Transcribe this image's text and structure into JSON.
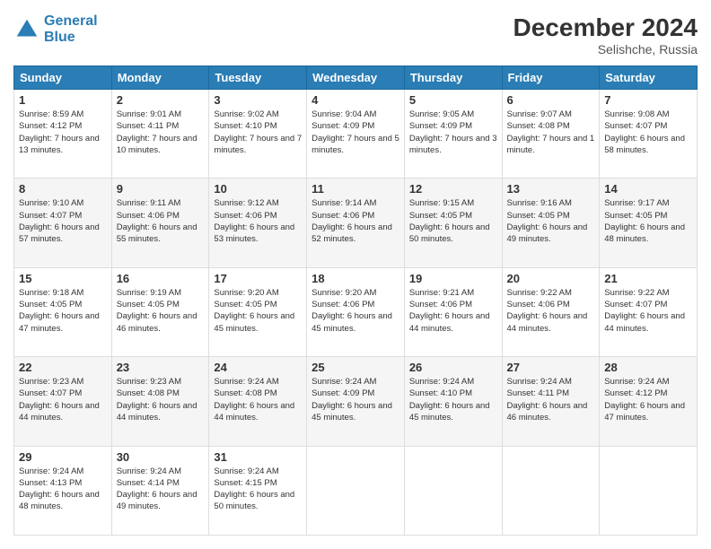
{
  "logo": {
    "line1": "General",
    "line2": "Blue"
  },
  "title": "December 2024",
  "location": "Selishche, Russia",
  "days_header": [
    "Sunday",
    "Monday",
    "Tuesday",
    "Wednesday",
    "Thursday",
    "Friday",
    "Saturday"
  ],
  "weeks": [
    [
      {
        "day": "1",
        "sunrise": "8:59 AM",
        "sunset": "4:12 PM",
        "daylight": "7 hours and 13 minutes."
      },
      {
        "day": "2",
        "sunrise": "9:01 AM",
        "sunset": "4:11 PM",
        "daylight": "7 hours and 10 minutes."
      },
      {
        "day": "3",
        "sunrise": "9:02 AM",
        "sunset": "4:10 PM",
        "daylight": "7 hours and 7 minutes."
      },
      {
        "day": "4",
        "sunrise": "9:04 AM",
        "sunset": "4:09 PM",
        "daylight": "7 hours and 5 minutes."
      },
      {
        "day": "5",
        "sunrise": "9:05 AM",
        "sunset": "4:09 PM",
        "daylight": "7 hours and 3 minutes."
      },
      {
        "day": "6",
        "sunrise": "9:07 AM",
        "sunset": "4:08 PM",
        "daylight": "7 hours and 1 minute."
      },
      {
        "day": "7",
        "sunrise": "9:08 AM",
        "sunset": "4:07 PM",
        "daylight": "6 hours and 58 minutes."
      }
    ],
    [
      {
        "day": "8",
        "sunrise": "9:10 AM",
        "sunset": "4:07 PM",
        "daylight": "6 hours and 57 minutes."
      },
      {
        "day": "9",
        "sunrise": "9:11 AM",
        "sunset": "4:06 PM",
        "daylight": "6 hours and 55 minutes."
      },
      {
        "day": "10",
        "sunrise": "9:12 AM",
        "sunset": "4:06 PM",
        "daylight": "6 hours and 53 minutes."
      },
      {
        "day": "11",
        "sunrise": "9:14 AM",
        "sunset": "4:06 PM",
        "daylight": "6 hours and 52 minutes."
      },
      {
        "day": "12",
        "sunrise": "9:15 AM",
        "sunset": "4:05 PM",
        "daylight": "6 hours and 50 minutes."
      },
      {
        "day": "13",
        "sunrise": "9:16 AM",
        "sunset": "4:05 PM",
        "daylight": "6 hours and 49 minutes."
      },
      {
        "day": "14",
        "sunrise": "9:17 AM",
        "sunset": "4:05 PM",
        "daylight": "6 hours and 48 minutes."
      }
    ],
    [
      {
        "day": "15",
        "sunrise": "9:18 AM",
        "sunset": "4:05 PM",
        "daylight": "6 hours and 47 minutes."
      },
      {
        "day": "16",
        "sunrise": "9:19 AM",
        "sunset": "4:05 PM",
        "daylight": "6 hours and 46 minutes."
      },
      {
        "day": "17",
        "sunrise": "9:20 AM",
        "sunset": "4:05 PM",
        "daylight": "6 hours and 45 minutes."
      },
      {
        "day": "18",
        "sunrise": "9:20 AM",
        "sunset": "4:06 PM",
        "daylight": "6 hours and 45 minutes."
      },
      {
        "day": "19",
        "sunrise": "9:21 AM",
        "sunset": "4:06 PM",
        "daylight": "6 hours and 44 minutes."
      },
      {
        "day": "20",
        "sunrise": "9:22 AM",
        "sunset": "4:06 PM",
        "daylight": "6 hours and 44 minutes."
      },
      {
        "day": "21",
        "sunrise": "9:22 AM",
        "sunset": "4:07 PM",
        "daylight": "6 hours and 44 minutes."
      }
    ],
    [
      {
        "day": "22",
        "sunrise": "9:23 AM",
        "sunset": "4:07 PM",
        "daylight": "6 hours and 44 minutes."
      },
      {
        "day": "23",
        "sunrise": "9:23 AM",
        "sunset": "4:08 PM",
        "daylight": "6 hours and 44 minutes."
      },
      {
        "day": "24",
        "sunrise": "9:24 AM",
        "sunset": "4:08 PM",
        "daylight": "6 hours and 44 minutes."
      },
      {
        "day": "25",
        "sunrise": "9:24 AM",
        "sunset": "4:09 PM",
        "daylight": "6 hours and 45 minutes."
      },
      {
        "day": "26",
        "sunrise": "9:24 AM",
        "sunset": "4:10 PM",
        "daylight": "6 hours and 45 minutes."
      },
      {
        "day": "27",
        "sunrise": "9:24 AM",
        "sunset": "4:11 PM",
        "daylight": "6 hours and 46 minutes."
      },
      {
        "day": "28",
        "sunrise": "9:24 AM",
        "sunset": "4:12 PM",
        "daylight": "6 hours and 47 minutes."
      }
    ],
    [
      {
        "day": "29",
        "sunrise": "9:24 AM",
        "sunset": "4:13 PM",
        "daylight": "6 hours and 48 minutes."
      },
      {
        "day": "30",
        "sunrise": "9:24 AM",
        "sunset": "4:14 PM",
        "daylight": "6 hours and 49 minutes."
      },
      {
        "day": "31",
        "sunrise": "9:24 AM",
        "sunset": "4:15 PM",
        "daylight": "6 hours and 50 minutes."
      },
      null,
      null,
      null,
      null
    ]
  ]
}
